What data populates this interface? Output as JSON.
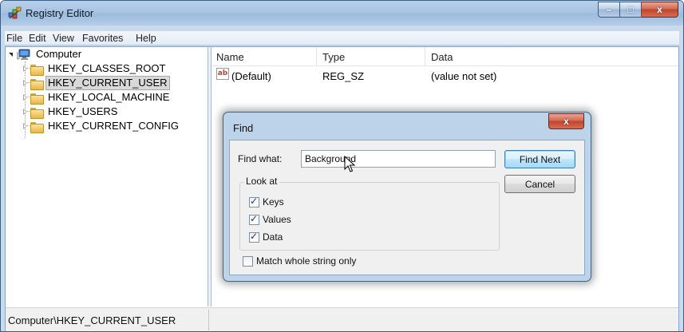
{
  "window": {
    "title": "Registry Editor",
    "caption": {
      "minimize": "–",
      "maximize": "□",
      "close": "x"
    }
  },
  "menu": [
    "File",
    "Edit",
    "View",
    "Favorites",
    "Help"
  ],
  "tree": {
    "root": "Computer",
    "items": [
      {
        "label": "HKEY_CLASSES_ROOT",
        "selected": false
      },
      {
        "label": "HKEY_CURRENT_USER",
        "selected": true
      },
      {
        "label": "HKEY_LOCAL_MACHINE",
        "selected": false
      },
      {
        "label": "HKEY_USERS",
        "selected": false
      },
      {
        "label": "HKEY_CURRENT_CONFIG",
        "selected": false
      }
    ]
  },
  "list": {
    "columns": [
      "Name",
      "Type",
      "Data"
    ],
    "rows": [
      {
        "icon": "ab",
        "name": "(Default)",
        "type": "REG_SZ",
        "data": "(value not set)"
      }
    ]
  },
  "status": {
    "path": "Computer\\HKEY_CURRENT_USER"
  },
  "find_dialog": {
    "title": "Find",
    "close": "x",
    "find_what_label": "Find what:",
    "find_what_value": "Background",
    "look_at_label": "Look at",
    "options": [
      {
        "label": "Keys",
        "checked": true
      },
      {
        "label": "Values",
        "checked": true
      },
      {
        "label": "Data",
        "checked": true
      }
    ],
    "match_whole": {
      "label": "Match whole string only",
      "checked": false
    },
    "find_next_label": "Find Next",
    "cancel_label": "Cancel"
  },
  "colors": {
    "title_bar": "#a6c2e2",
    "close_button": "#c0452c",
    "default_button_border": "#3c7fb1"
  }
}
